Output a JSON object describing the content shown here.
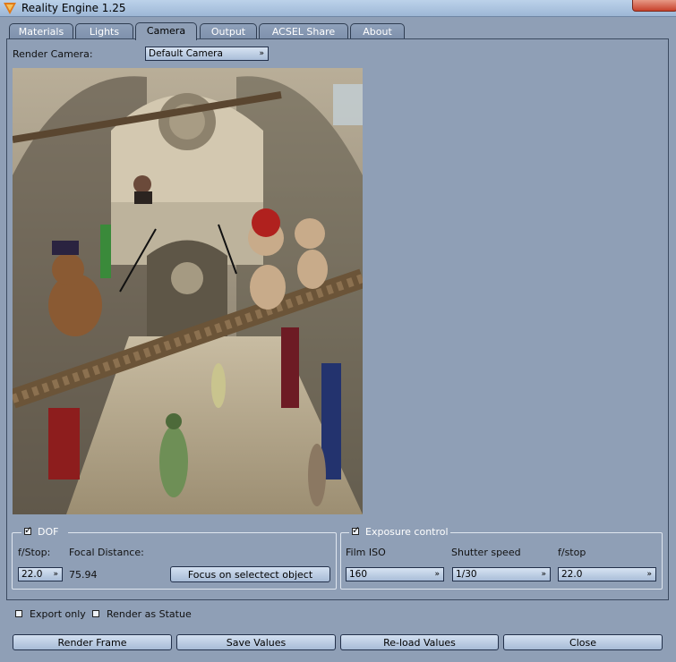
{
  "window": {
    "title": "Reality Engine 1.25"
  },
  "tabs": [
    {
      "label": "Materials"
    },
    {
      "label": "Lights"
    },
    {
      "label": "Camera"
    },
    {
      "label": "Output"
    },
    {
      "label": "ACSEL Share"
    },
    {
      "label": "About"
    }
  ],
  "active_tab": "Camera",
  "camera": {
    "render_camera_label": "Render Camera:",
    "render_camera_value": "Default Camera"
  },
  "dof": {
    "title": "DOF",
    "enabled": true,
    "fstop_label": "f/Stop:",
    "fstop_value": "22.0",
    "focal_label": "Focal Distance:",
    "focal_value": "75.94",
    "focus_button": "Focus on selectect object"
  },
  "exposure": {
    "title": "Exposure control",
    "enabled": true,
    "iso_label": "Film ISO",
    "iso_value": "160",
    "shutter_label": "Shutter speed",
    "shutter_value": "1/30",
    "fstop_label": "f/stop",
    "fstop_value": "22.0"
  },
  "options": {
    "export_only": "Export only",
    "render_statue": "Render as Statue"
  },
  "buttons": {
    "render": "Render Frame",
    "save": "Save Values",
    "reload": "Re-load Values",
    "close": "Close"
  },
  "colors": {
    "background": "#8f9fb6",
    "button_border": "#22304a"
  }
}
